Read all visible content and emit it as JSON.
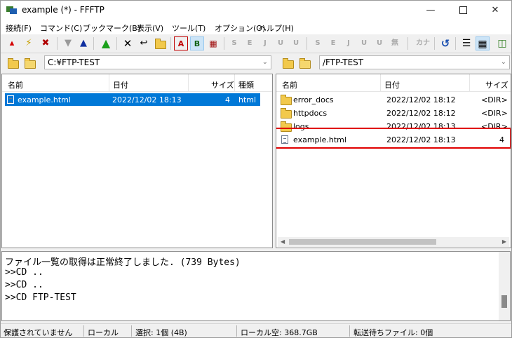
{
  "window": {
    "title": "example (*) - FFFTP"
  },
  "menu": [
    "接続(F)",
    "コマンド(C)",
    "ブックマーク(B)",
    "表示(V)",
    "ツール(T)",
    "オプション(O)",
    "ヘルプ(H)"
  ],
  "toolbar": {
    "icons": [
      "connect-icon",
      "quick-connect-icon",
      "disconnect-icon",
      "download-icon",
      "upload-icon",
      "mirror-upload-icon",
      "delete-icon",
      "rename-icon",
      "mkdir-icon",
      "ascii-mode-icon",
      "binary-mode-icon",
      "auto-mode-icon",
      "sjis-icon",
      "euc-icon",
      "jis-icon",
      "utf8-icon",
      "utf8bom-icon",
      "sjis-remote-icon",
      "euc-remote-icon",
      "jis-remote-icon",
      "utf8-remote-icon",
      "utf8bom-remote-icon",
      "no-convert-icon",
      "kana-icon",
      "refresh-icon",
      "list-view-icon",
      "detail-view-icon",
      "sync-folder-icon"
    ],
    "labels": {
      "ascii": "A",
      "binary": "B",
      "s": "S",
      "e": "E",
      "j": "J",
      "u": "U",
      "none": "無",
      "kana": "カナ"
    }
  },
  "local": {
    "path": "C:¥FTP-TEST",
    "columns": {
      "name": "名前",
      "date": "日付",
      "size": "サイズ",
      "type": "種類"
    },
    "files": [
      {
        "name": "example.html",
        "date": "2022/12/02 18:13",
        "size": "4",
        "type": "html",
        "selected": true
      }
    ]
  },
  "remote": {
    "path": "/FTP-TEST",
    "columns": {
      "name": "名前",
      "date": "日付",
      "size": "サイズ"
    },
    "files": [
      {
        "name": "error_docs",
        "date": "2022/12/02 18:12",
        "size": "<DIR>",
        "kind": "folder"
      },
      {
        "name": "httpdocs",
        "date": "2022/12/02 18:12",
        "size": "<DIR>",
        "kind": "folder"
      },
      {
        "name": "logs",
        "date": "2022/12/02 18:13",
        "size": "<DIR>",
        "kind": "folder"
      },
      {
        "name": "example.html",
        "date": "2022/12/02 18:13",
        "size": "4",
        "kind": "file",
        "highlighted": true
      }
    ]
  },
  "log": [
    "ファイル一覧の取得は正常終了しました. (739 Bytes)",
    ">>CD ..",
    ">>CD ..",
    ">>CD FTP-TEST"
  ],
  "status": {
    "security": "保護されていません",
    "location": "ローカル",
    "selection": "選択: 1個 (4B)",
    "free_space": "ローカル空: 368.7GB",
    "queue": "転送待ちファイル: 0個"
  },
  "colors": {
    "selection": "#0078d7",
    "highlight_box": "#e00000"
  }
}
